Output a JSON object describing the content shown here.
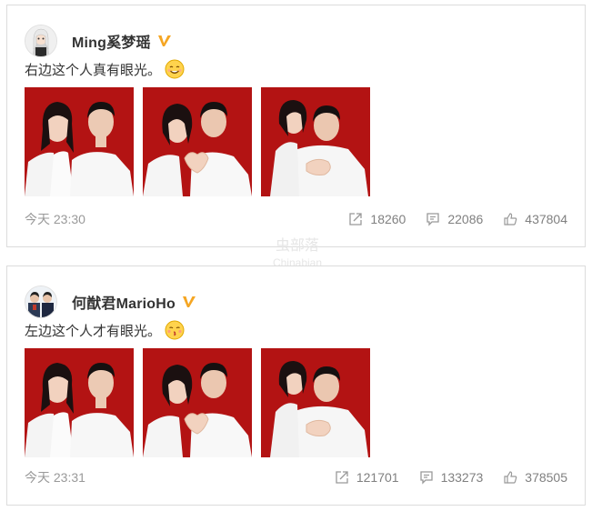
{
  "posts": [
    {
      "username": "Ming奚梦瑶",
      "text": "右边这个人真有眼光。",
      "emoji": "smile-emoji",
      "time": "今天  23:30",
      "reposts": "18260",
      "comments": "22086",
      "likes": "437804"
    },
    {
      "username": "何猷君MarioHo",
      "text": "左边这个人才有眼光。",
      "emoji": "kiss-emoji",
      "time": "今天  23:31",
      "reposts": "121701",
      "comments": "133273",
      "likes": "378505"
    }
  ],
  "watermark": {
    "line1": "虫部落",
    "line2": "Chinabian"
  },
  "colors": {
    "photo_background": "#b31313",
    "verified_badge": "#f5a623",
    "meta_text": "#999999"
  }
}
